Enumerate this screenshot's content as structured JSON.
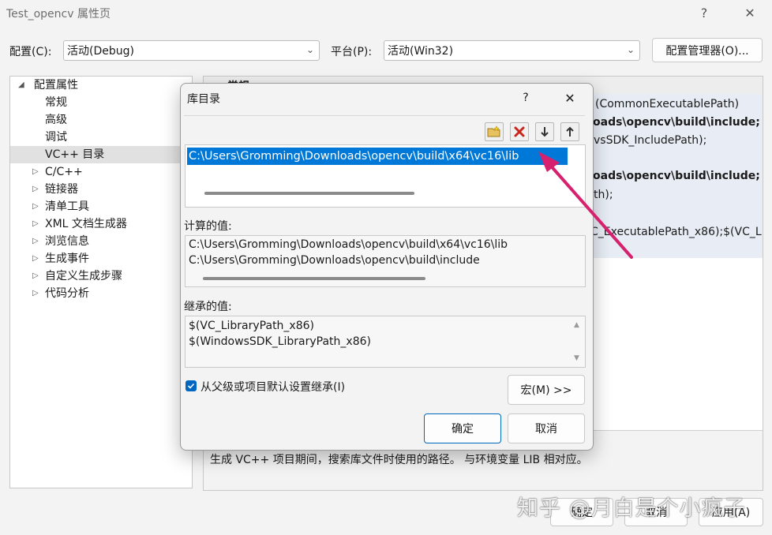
{
  "window": {
    "title": "Test_opencv 属性页",
    "help_glyph": "?",
    "close_glyph": "✕"
  },
  "config_row": {
    "config_label": "配置(C):",
    "config_value": "活动(Debug)",
    "platform_label": "平台(P):",
    "platform_value": "活动(Win32)",
    "manager_button": "配置管理器(O)..."
  },
  "tree": {
    "root": "配置属性",
    "items": [
      {
        "label": "常规",
        "expandable": false
      },
      {
        "label": "高级",
        "expandable": false
      },
      {
        "label": "调试",
        "expandable": false
      },
      {
        "label": "VC++ 目录",
        "expandable": false,
        "selected": true
      },
      {
        "label": "C/C++",
        "expandable": true
      },
      {
        "label": "链接器",
        "expandable": true
      },
      {
        "label": "清单工具",
        "expandable": true
      },
      {
        "label": "XML 文档生成器",
        "expandable": true
      },
      {
        "label": "浏览信息",
        "expandable": true
      },
      {
        "label": "生成事件",
        "expandable": true
      },
      {
        "label": "自定义生成步骤",
        "expandable": true
      },
      {
        "label": "代码分析",
        "expandable": true
      }
    ]
  },
  "right_panel": {
    "header": "常规",
    "lines": [
      "(CommonExecutablePath)",
      "oads\\opencv\\build\\include;",
      "vsSDK_IncludePath);",
      "oads\\opencv\\build\\include;",
      "th);",
      "C_ExecutablePath_x86);$(VC_L"
    ],
    "description": "生成 VC++ 项目期间，搜索库文件时使用的路径。 与环境变量 LIB 相对应。"
  },
  "modal": {
    "title": "库目录",
    "help_glyph": "?",
    "close_glyph": "✕",
    "toolbar_icons": [
      "new-folder-icon",
      "delete-icon",
      "move-down-icon",
      "move-up-icon"
    ],
    "entries": [
      "C:\\Users\\Gromming\\Downloads\\opencv\\build\\x64\\vc16\\lib"
    ],
    "computed_label": "计算的值:",
    "computed_values": [
      "C:\\Users\\Gromming\\Downloads\\opencv\\build\\x64\\vc16\\lib",
      "C:\\Users\\Gromming\\Downloads\\opencv\\build\\include"
    ],
    "inherited_label": "继承的值:",
    "inherited_values": [
      "$(VC_LibraryPath_x86)",
      "$(WindowsSDK_LibraryPath_x86)"
    ],
    "inherit_checkbox": {
      "label": "从父级或项目默认设置继承(I)",
      "checked": true
    },
    "macro_button": "宏(M) >>",
    "ok_button": "确定",
    "cancel_button": "取消"
  },
  "bottom_buttons": {
    "ok": "确定",
    "cancel": "取消",
    "apply": "应用(A)"
  },
  "watermark": "知乎 @月白是个小疯子",
  "colors": {
    "accent": "#0067c0",
    "selection": "#0078d7",
    "arrow": "#d6226e"
  }
}
